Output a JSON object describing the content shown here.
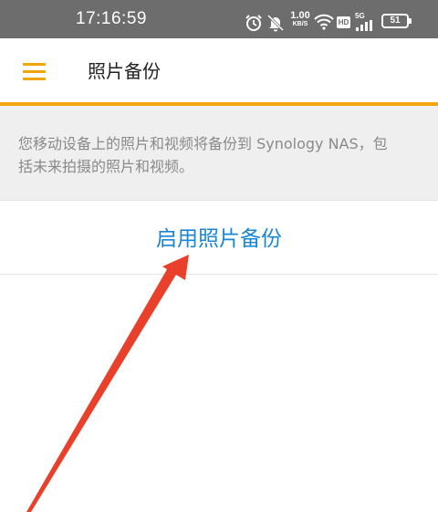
{
  "status_bar": {
    "time": "17:16:59",
    "net_speed_value": "1.00",
    "net_speed_unit": "KB/S",
    "hd_label": "HD",
    "signal_label": "5G",
    "battery": "51",
    "icons": [
      "alarm-icon",
      "mute-icon",
      "wifi-icon",
      "hd-icon",
      "signal-icon",
      "battery-icon"
    ]
  },
  "app_bar": {
    "menu_icon": "hamburger-menu-icon",
    "title": "照片备份"
  },
  "info": {
    "text": "您移动设备上的照片和视频将备份到 Synology NAS，包括未来拍摄的照片和视频。"
  },
  "actions": {
    "enable_label": "启用照片备份"
  },
  "colors": {
    "status_bar_bg": "#6d6d6d",
    "accent": "#f4a50b",
    "link": "#1a86d6",
    "panel_bg": "#efefef",
    "annotation_arrow": "#e8402a"
  }
}
